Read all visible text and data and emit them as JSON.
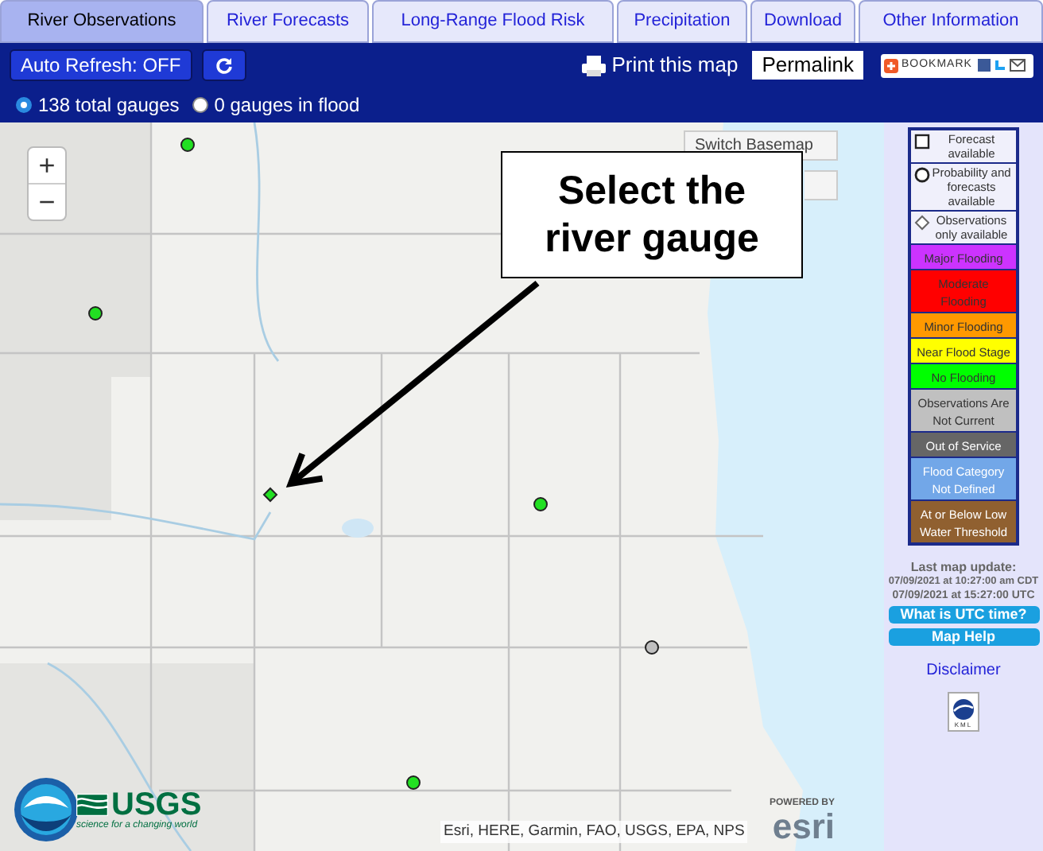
{
  "tabs": [
    {
      "label": "River Observations",
      "selected": true
    },
    {
      "label": "River Forecasts",
      "selected": false
    },
    {
      "label": "Long-Range Flood Risk",
      "selected": false
    },
    {
      "label": "Precipitation",
      "selected": false
    },
    {
      "label": "Download",
      "selected": false
    },
    {
      "label": "Other Information",
      "selected": false
    }
  ],
  "toolbar": {
    "auto_refresh": "Auto Refresh: OFF",
    "print": "Print this map",
    "permalink": "Permalink",
    "bookmark": "BOOKMARK"
  },
  "gauge_filter": [
    {
      "label": "138 total gauges",
      "selected": true
    },
    {
      "label": "0 gauges in flood",
      "selected": false
    }
  ],
  "map": {
    "kind": "picture",
    "zoom_in": "+",
    "zoom_out": "−",
    "basemap_button": "Switch Basemap",
    "callout": "Select the river gauge",
    "attribution": "Esri, HERE, Garmin, FAO, USGS, EPA, NPS",
    "usgs_logo": "USGS",
    "usgs_tagline": "science for a changing world",
    "esri_powered": "POWERED BY",
    "esri_logo": "esri"
  },
  "legend": [
    {
      "kind": "square",
      "label": "Forecast available"
    },
    {
      "kind": "circle",
      "label": "Probability and forecasts available"
    },
    {
      "kind": "diamond",
      "label": "Observations only available"
    },
    {
      "kind": "light-swatch",
      "label": "Major Flooding",
      "color": "#cc33ff"
    },
    {
      "kind": "light-swatch",
      "label": "Moderate Flooding",
      "color": "#ff0000"
    },
    {
      "kind": "light-swatch",
      "label": "Minor Flooding",
      "color": "#ff9900"
    },
    {
      "kind": "light-swatch",
      "label": "Near Flood Stage",
      "color": "#ffff00"
    },
    {
      "kind": "light-swatch",
      "label": "No Flooding",
      "color": "#00ff00"
    },
    {
      "kind": "light-swatch",
      "label": "Observations Are Not Current",
      "color": "#c0c0c0"
    },
    {
      "kind": "dark-swatch",
      "label": "Out of Service",
      "color": "#666666"
    },
    {
      "kind": "dark-swatch",
      "label": "Flood Category Not Defined",
      "color": "#72a7e8"
    },
    {
      "kind": "dark-swatch",
      "label": "At or Below Low Water Threshold",
      "color": "#906030"
    }
  ],
  "last_update": {
    "title": "Last map update:",
    "local": "07/09/2021 at 10:27:00 am CDT",
    "utc": "07/09/2021 at 15:27:00 UTC"
  },
  "buttons": [
    "What is UTC time?",
    "Map Help"
  ],
  "disclaimer": "Disclaimer",
  "kml": "KML"
}
